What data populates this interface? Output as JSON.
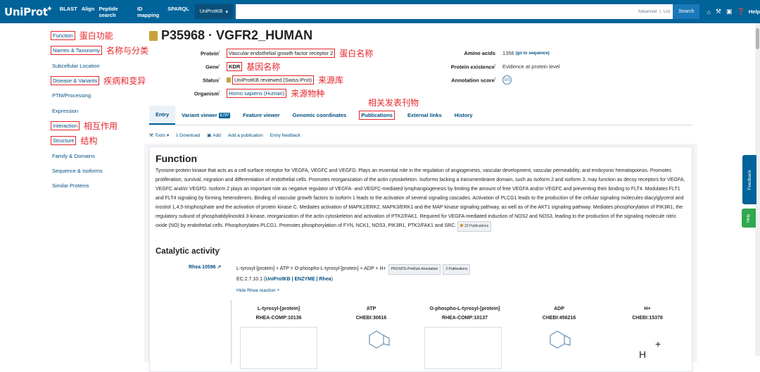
{
  "topbar": {
    "logo": "UniProt",
    "nav": [
      "BLAST",
      "Align",
      "Peptide search",
      "ID mapping",
      "SPARQL"
    ],
    "db_select": "UniProtKB",
    "advanced": "Advanced",
    "list": "List",
    "search_button": "Search",
    "help": "Help"
  },
  "sidebar": {
    "items": [
      {
        "label": "Function",
        "anno": "蛋白功能"
      },
      {
        "label": "Names & Taxonomy",
        "anno": "名称与分类"
      },
      {
        "label": "Subcellular Location",
        "anno": ""
      },
      {
        "label": "Disease & Variants",
        "anno": "疾病和变异"
      },
      {
        "label": "PTM/Processing",
        "anno": ""
      },
      {
        "label": "Expression",
        "anno": ""
      },
      {
        "label": "Interaction",
        "anno": "相互作用"
      },
      {
        "label": "Structure",
        "anno": "结构"
      },
      {
        "label": "Family & Domains",
        "anno": ""
      },
      {
        "label": "Sequence & Isoforms",
        "anno": ""
      },
      {
        "label": "Similar Proteins",
        "anno": ""
      }
    ]
  },
  "entry": {
    "title": "P35968 · VGFR2_HUMAN",
    "protein_label": "Protein",
    "protein": "Vascular endothelial growth factor receptor 2",
    "protein_anno": "蛋白名称",
    "gene_label": "Gene",
    "gene": "KDR",
    "gene_anno": "基因名称",
    "status_label": "Status",
    "status": "UniProtKB reviewed (Swiss-Prot)",
    "status_anno": "来源库",
    "organism_label": "Organism",
    "organism": "Homo sapiens (Human)",
    "organism_anno": "来源物种",
    "amino_acids_label": "Amino acids",
    "amino_acids": "1356",
    "goto_sequence": "(go to sequence)",
    "existence_label": "Protein existence",
    "existence": "Evidence at protein level",
    "annotation_label": "Annotation score",
    "annotation_score": "5/5",
    "pubs_anno": "相关发表刊物"
  },
  "tabs": [
    {
      "label": "Entry"
    },
    {
      "label": "Variant viewer",
      "count": "5,727"
    },
    {
      "label": "Feature viewer"
    },
    {
      "label": "Genomic coordinates"
    },
    {
      "label": "Publications"
    },
    {
      "label": "External links"
    },
    {
      "label": "History"
    }
  ],
  "toolbar": [
    "Tools",
    "Download",
    "Add",
    "Add a publication",
    "Entry feedback"
  ],
  "function": {
    "heading": "Function",
    "text": "Tyrosine-protein kinase that acts as a cell-surface receptor for VEGFA, VEGFC and VEGFD. Plays an essential role in the regulation of angiogenesis, vascular development, vascular permeability, and embryonic hematopoiesis. Promotes proliferation, survival, migration and differentiation of endothelial cells. Promotes reorganization of the actin cytoskeleton. Isoforms lacking a transmembrane domain, such as isoform 2 and isoform 3, may function as decoy receptors for VEGFA, VEGFC and/or VEGFD. Isoform 2 plays an important role as negative regulator of VEGFA- and VEGFC-mediated lymphangiogenesis by limiting the amount of free VEGFA and/or VEGFC and preventing their binding to FLT4. Modulates FLT1 and FLT4 signaling by forming heterodimers. Binding of vascular growth factors to isoform 1 leads to the activation of several signaling cascades. Activation of PLCG1 leads to the production of the cellular signaling molecules diacylglycerol and inositol 1,4,5-trisphosphate and the activation of protein kinase C. Mediates activation of MAPK1/ERK2, MAPK3/ERK1 and the MAP kinase signaling pathway, as well as of the AKT1 signaling pathway. Mediates phosphorylation of PIK3R1, the regulatory subunit of phosphatidylinositol 3-kinase, reorganization of the actin cytoskeleton and activation of PTK2/FAK1. Required for VEGFA-mediated induction of NOS2 and NOS3, leading to the production of the signaling molecule nitric oxide (NO) by endothelial cells. Phosphorylates PLCG1. Promotes phosphorylation of FYN, NCK1, NOS3, PIK3R1, PTK2/FAK1 and SRC.",
    "pubs": "23 Publications"
  },
  "catalytic": {
    "heading": "Catalytic activity",
    "rhea_id": "Rhea 10596",
    "equation": "L-tyrosyl-[protein] + ATP = O-phospho-L-tyrosyl-[protein] + ADP + H+",
    "prosite": "PROSITE-ProRule Annotation",
    "pubs": "2 Publications",
    "ec": "EC:2.7.10.1 (",
    "ec_links": "UniProtKB | ENZYME | Rhea",
    "ec_end": ")",
    "hide": "Hide Rhea reaction",
    "compounds": [
      {
        "name": "L-tyrosyl-[protein]",
        "id": "RHEA-COMP:10136"
      },
      {
        "name": "ATP",
        "id": "CHEBI:30616"
      },
      {
        "name": "O-phospho-L-tyrosyl-[protein]",
        "id": "RHEA-COMP:10137"
      },
      {
        "name": "ADP",
        "id": "CHEBI:456216"
      },
      {
        "name": "H+",
        "id": "CHEBI:15378"
      }
    ],
    "plus": "+",
    "h_symbol": "H"
  },
  "side_tabs": {
    "feedback": "Feedback",
    "help": "Help"
  }
}
